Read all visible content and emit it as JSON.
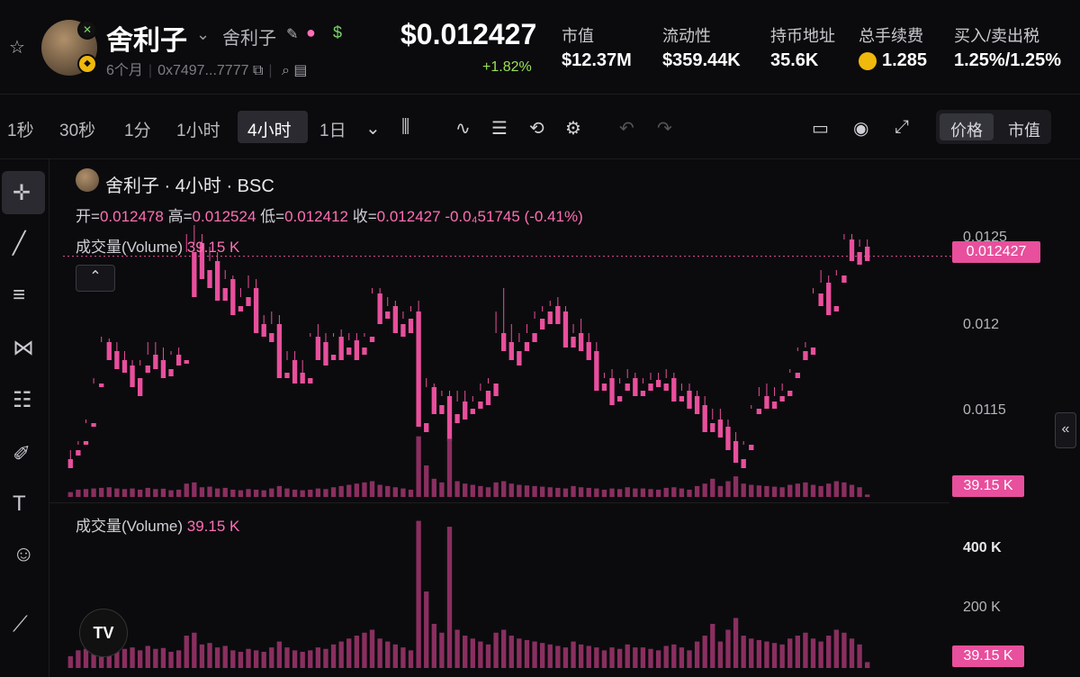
{
  "header": {
    "token_name": "舍利子",
    "token_sub": "舍利子",
    "age": "6个月",
    "address": "0x7497...7777",
    "price": "$0.012427",
    "change": "+1.82%",
    "stats": [
      {
        "label": "市值",
        "value": "$12.37M"
      },
      {
        "label": "流动性",
        "value": "$359.44K"
      },
      {
        "label": "持币地址",
        "value": "35.6K"
      },
      {
        "label": "总手续费",
        "value": "1.285"
      },
      {
        "label": "买入/卖出税",
        "value": "1.25%/1.25%"
      }
    ],
    "icons": {
      "star": "star-icon",
      "edit": "edit-icon",
      "chef": "chef-hat-icon",
      "bag": "money-bag-icon",
      "copy": "copy-icon",
      "search": "search-icon",
      "card": "card-icon"
    }
  },
  "toolbar": {
    "timeframes": [
      "1秒",
      "30秒",
      "1分",
      "1小时",
      "4小时",
      "1日"
    ],
    "active_timeframe": "4小时",
    "toggle": [
      "价格",
      "市值"
    ],
    "active_toggle": "价格"
  },
  "legend": {
    "title": "舍利子 · 4小时 · BSC",
    "open_label": "开=",
    "open": "0.012478",
    "high_label": "高=",
    "high": "0.012524",
    "low_label": "低=",
    "low": "0.012412",
    "close_label": "收=",
    "close": "0.012427",
    "change": "-0.0₄51745 (-0.41%)",
    "volume_label": "成交量(Volume)",
    "volume_value": "39.15 K"
  },
  "price_axis": {
    "ticks": [
      "0.0125",
      "0.012",
      "0.0115"
    ],
    "current_price": "0.012427",
    "volume_tag": "39.15 K"
  },
  "volume_axis": {
    "ticks": [
      "400 K",
      "200 K"
    ],
    "volume_tag": "39.15 K"
  },
  "colors": {
    "up": "#b8e05a",
    "down": "#e84f9c",
    "vol_up": "#6f8a2c",
    "vol_down": "#8a2f60",
    "bg": "#0b0b0d"
  },
  "chart_data": {
    "type": "candlestick",
    "price_range": [
      0.01125,
      0.0126
    ],
    "volume_range": [
      0,
      520
    ],
    "candles": [
      [
        0.0113,
        0.01135,
        0.01128,
        0.01125
      ],
      [
        0.01135,
        0.0114,
        0.01138,
        0.01132
      ],
      [
        0.0114,
        0.01152,
        0.0115,
        0.01138
      ],
      [
        0.0115,
        0.01175,
        0.01172,
        0.01148
      ],
      [
        0.01172,
        0.01198,
        0.01195,
        0.0117
      ],
      [
        0.01195,
        0.01197,
        0.0119,
        0.01185
      ],
      [
        0.0119,
        0.01195,
        0.01185,
        0.0118
      ],
      [
        0.01185,
        0.0119,
        0.01182,
        0.01178
      ],
      [
        0.01182,
        0.01185,
        0.01175,
        0.0117
      ],
      [
        0.01175,
        0.01185,
        0.01182,
        0.01165
      ],
      [
        0.01182,
        0.01195,
        0.01188,
        0.01178
      ],
      [
        0.01188,
        0.01195,
        0.01185,
        0.0118
      ],
      [
        0.01185,
        0.01192,
        0.0118,
        0.01175
      ],
      [
        0.0118,
        0.0119,
        0.01188,
        0.01176
      ],
      [
        0.01188,
        0.01192,
        0.01185,
        0.01182
      ],
      [
        0.01185,
        0.01255,
        0.01245,
        0.01183
      ],
      [
        0.01245,
        0.0126,
        0.0125,
        0.0122
      ],
      [
        0.0125,
        0.01255,
        0.01235,
        0.0123
      ],
      [
        0.01235,
        0.01248,
        0.0124,
        0.01225
      ],
      [
        0.0124,
        0.01245,
        0.01225,
        0.01218
      ],
      [
        0.01225,
        0.01235,
        0.0123,
        0.01218
      ],
      [
        0.0123,
        0.01232,
        0.01215,
        0.0121
      ],
      [
        0.01215,
        0.01225,
        0.0122,
        0.01212
      ],
      [
        0.0122,
        0.01232,
        0.01225,
        0.01215
      ],
      [
        0.01225,
        0.0123,
        0.01205,
        0.012
      ],
      [
        0.01205,
        0.0121,
        0.012,
        0.01198
      ],
      [
        0.012,
        0.01212,
        0.01205,
        0.01195
      ],
      [
        0.01205,
        0.0121,
        0.01178,
        0.01175
      ],
      [
        0.01178,
        0.0119,
        0.01185,
        0.01175
      ],
      [
        0.01185,
        0.0119,
        0.01178,
        0.01172
      ],
      [
        0.01178,
        0.01185,
        0.01175,
        0.01172
      ],
      [
        0.01175,
        0.012,
        0.01198,
        0.01172
      ],
      [
        0.01198,
        0.01205,
        0.01195,
        0.01185
      ],
      [
        0.01195,
        0.012,
        0.01188,
        0.01182
      ],
      [
        0.01188,
        0.012,
        0.01198,
        0.01185
      ],
      [
        0.01198,
        0.01202,
        0.01192,
        0.01185
      ],
      [
        0.01192,
        0.012,
        0.01196,
        0.01188
      ],
      [
        0.01196,
        0.012,
        0.01192,
        0.01185
      ],
      [
        0.01192,
        0.012,
        0.01198,
        0.01188
      ],
      [
        0.01198,
        0.01225,
        0.01222,
        0.01195
      ],
      [
        0.01222,
        0.01225,
        0.01212,
        0.01205
      ],
      [
        0.01212,
        0.0122,
        0.01215,
        0.01208
      ],
      [
        0.01215,
        0.01218,
        0.01205,
        0.012
      ],
      [
        0.01205,
        0.01212,
        0.01208,
        0.01198
      ],
      [
        0.01208,
        0.01215,
        0.01212,
        0.012
      ],
      [
        0.01212,
        0.01218,
        0.0115,
        0.01148
      ],
      [
        0.0115,
        0.01175,
        0.0117,
        0.01145
      ],
      [
        0.0117,
        0.01172,
        0.0116,
        0.01155
      ],
      [
        0.0116,
        0.01168,
        0.01165,
        0.01155
      ],
      [
        0.01165,
        0.01168,
        0.01155,
        0.0114
      ],
      [
        0.01155,
        0.01168,
        0.01162,
        0.0115
      ],
      [
        0.01162,
        0.01168,
        0.01158,
        0.01152
      ],
      [
        0.01158,
        0.01165,
        0.01162,
        0.01155
      ],
      [
        0.01162,
        0.01172,
        0.01168,
        0.01158
      ],
      [
        0.01168,
        0.01175,
        0.01172,
        0.0116
      ],
      [
        0.01172,
        0.01212,
        0.012,
        0.01165
      ],
      [
        0.012,
        0.01225,
        0.01195,
        0.0119
      ],
      [
        0.01195,
        0.01205,
        0.0119,
        0.01185
      ],
      [
        0.0119,
        0.012,
        0.01195,
        0.01182
      ],
      [
        0.01195,
        0.01205,
        0.012,
        0.0119
      ],
      [
        0.012,
        0.01212,
        0.01208,
        0.01195
      ],
      [
        0.01208,
        0.01215,
        0.01212,
        0.01202
      ],
      [
        0.01212,
        0.01218,
        0.01215,
        0.01205
      ],
      [
        0.01215,
        0.0122,
        0.01212,
        0.01205
      ],
      [
        0.01212,
        0.01215,
        0.01198,
        0.01192
      ],
      [
        0.01198,
        0.01205,
        0.012,
        0.01192
      ],
      [
        0.012,
        0.01208,
        0.01195,
        0.0119
      ],
      [
        0.01195,
        0.012,
        0.0119,
        0.01185
      ],
      [
        0.0119,
        0.01195,
        0.01172,
        0.01168
      ],
      [
        0.01172,
        0.01178,
        0.01175,
        0.01168
      ],
      [
        0.01175,
        0.0118,
        0.01165,
        0.0116
      ],
      [
        0.01165,
        0.01175,
        0.01172,
        0.01162
      ],
      [
        0.01172,
        0.0118,
        0.01175,
        0.01168
      ],
      [
        0.01175,
        0.01178,
        0.01168,
        0.01165
      ],
      [
        0.01168,
        0.01175,
        0.01172,
        0.01165
      ],
      [
        0.01172,
        0.01178,
        0.01174,
        0.01168
      ],
      [
        0.01174,
        0.01178,
        0.01172,
        0.0117
      ],
      [
        0.01172,
        0.0118,
        0.01175,
        0.01168
      ],
      [
        0.01175,
        0.01178,
        0.01165,
        0.01162
      ],
      [
        0.01165,
        0.01172,
        0.01168,
        0.01162
      ],
      [
        0.01168,
        0.01172,
        0.01165,
        0.01158
      ],
      [
        0.01165,
        0.01168,
        0.0116,
        0.01155
      ],
      [
        0.0116,
        0.01165,
        0.0115,
        0.01145
      ],
      [
        0.0115,
        0.01158,
        0.01152,
        0.01145
      ],
      [
        0.01152,
        0.01158,
        0.01148,
        0.01142
      ],
      [
        0.01148,
        0.01152,
        0.0114,
        0.01135
      ],
      [
        0.0114,
        0.01145,
        0.0113,
        0.01128
      ],
      [
        0.0113,
        0.0114,
        0.01138,
        0.01125
      ],
      [
        0.01138,
        0.0116,
        0.01158,
        0.01135
      ],
      [
        0.01158,
        0.0117,
        0.01165,
        0.01155
      ],
      [
        0.01165,
        0.01172,
        0.01162,
        0.01158
      ],
      [
        0.01162,
        0.0117,
        0.01165,
        0.01158
      ],
      [
        0.01165,
        0.01172,
        0.01168,
        0.01162
      ],
      [
        0.01168,
        0.0118,
        0.01178,
        0.01165
      ],
      [
        0.01178,
        0.01192,
        0.0119,
        0.01175
      ],
      [
        0.0119,
        0.01195,
        0.01192,
        0.01185
      ],
      [
        0.01192,
        0.01225,
        0.01222,
        0.01188
      ],
      [
        0.01222,
        0.01235,
        0.01228,
        0.01215
      ],
      [
        0.01228,
        0.01232,
        0.01215,
        0.0121
      ],
      [
        0.01215,
        0.01235,
        0.01232,
        0.01212
      ],
      [
        0.01232,
        0.01255,
        0.01252,
        0.01228
      ],
      [
        0.01252,
        0.01255,
        0.01245,
        0.0124
      ],
      [
        0.01245,
        0.01252,
        0.01248,
        0.01238
      ],
      [
        0.01248,
        0.01252,
        0.01243,
        0.0124
      ]
    ],
    "volumes": [
      40,
      60,
      65,
      70,
      75,
      80,
      70,
      65,
      70,
      60,
      75,
      65,
      68,
      55,
      60,
      110,
      120,
      80,
      85,
      70,
      75,
      60,
      55,
      65,
      60,
      55,
      70,
      90,
      70,
      60,
      55,
      60,
      70,
      65,
      80,
      90,
      100,
      110,
      120,
      130,
      100,
      90,
      80,
      70,
      60,
      500,
      260,
      150,
      120,
      480,
      130,
      110,
      100,
      90,
      80,
      120,
      130,
      110,
      100,
      95,
      90,
      85,
      80,
      75,
      70,
      90,
      80,
      75,
      70,
      60,
      70,
      65,
      80,
      70,
      70,
      65,
      60,
      75,
      80,
      70,
      60,
      90,
      110,
      150,
      90,
      130,
      170,
      110,
      100,
      95,
      90,
      85,
      80,
      100,
      110,
      120,
      100,
      90,
      110,
      130,
      120,
      100,
      80,
      20
    ]
  },
  "left_tools": [
    "crosshair-icon",
    "trendline-icon",
    "horizontal-lines-icon",
    "pattern-icon",
    "fib-icon",
    "brush-icon",
    "text-icon",
    "emoji-icon",
    "ruler-icon"
  ]
}
